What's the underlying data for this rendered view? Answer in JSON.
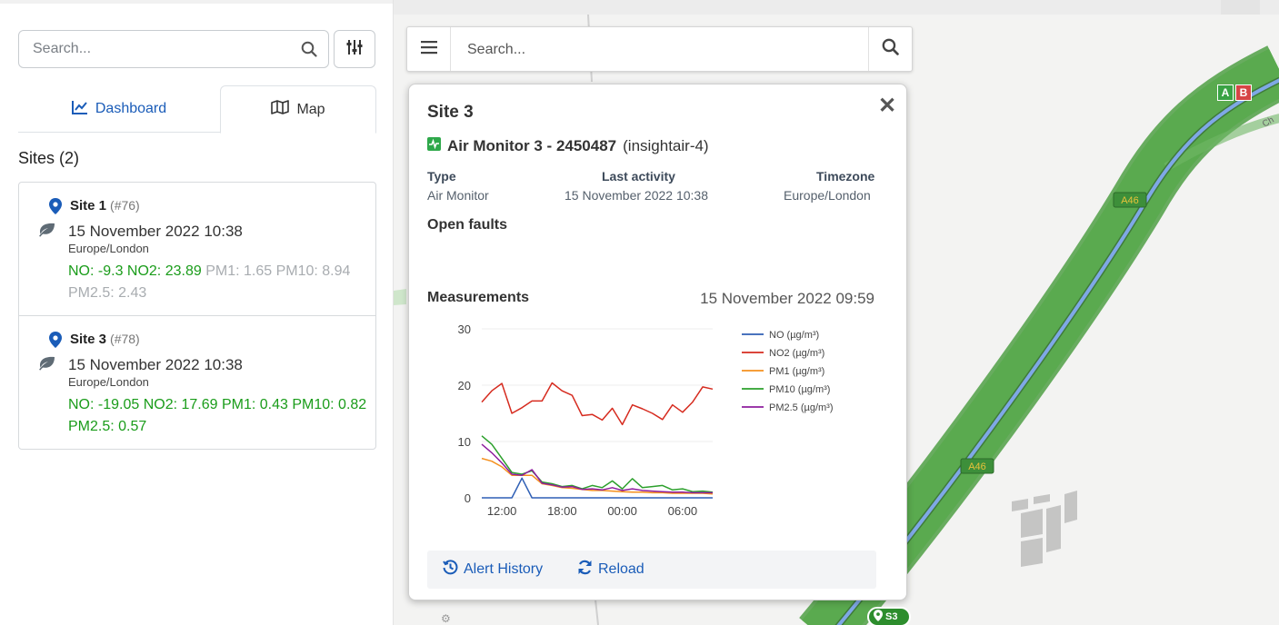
{
  "sidebar": {
    "search_placeholder": "Search...",
    "tabs": [
      {
        "label": "Dashboard",
        "icon": "chart-line-icon",
        "active": false
      },
      {
        "label": "Map",
        "icon": "map-icon",
        "active": true
      }
    ],
    "sites_title": "Sites (2)",
    "sites": [
      {
        "name": "Site 1",
        "id": "(#76)",
        "date": "15 November 2022 10:38",
        "timezone": "Europe/London",
        "values_green": "NO: -9.3 NO2: 23.89",
        "values_grey": "PM1: 1.65 PM10: 8.94 PM2.5: 2.43"
      },
      {
        "name": "Site 3",
        "id": "(#78)",
        "date": "15 November 2022 10:38",
        "timezone": "Europe/London",
        "values_green": "NO: -19.05 NO2: 17.69 PM1: 0.43 PM10: 0.82 PM2.5: 0.57",
        "values_grey": ""
      }
    ]
  },
  "map": {
    "search_placeholder": "Search...",
    "road_label": "A46",
    "flags": [
      "A",
      "B"
    ],
    "marker_label": "S3"
  },
  "popup": {
    "title": "Site 3",
    "device_name": "Air Monitor 3 - 2450487",
    "device_id": "(insightair-4)",
    "type_label": "Type",
    "type_value": "Air Monitor",
    "activity_label": "Last activity",
    "activity_value": "15 November 2022 10:38",
    "timezone_label": "Timezone",
    "timezone_value": "Europe/London",
    "faults_label": "Open faults",
    "measurements_label": "Measurements",
    "measurements_date": "15 November 2022 09:59",
    "alert_history_label": "Alert History",
    "reload_label": "Reload"
  },
  "colors": {
    "primary": "#1a5cb8",
    "green_value": "#1a9c1a",
    "route": "#5aaa4f"
  },
  "chart_data": {
    "type": "line",
    "x": [
      "10:00",
      "11:00",
      "12:00",
      "13:00",
      "14:00",
      "15:00",
      "16:00",
      "17:00",
      "18:00",
      "19:00",
      "20:00",
      "21:00",
      "22:00",
      "23:00",
      "00:00",
      "01:00",
      "02:00",
      "03:00",
      "04:00",
      "05:00",
      "06:00",
      "07:00",
      "08:00",
      "09:00"
    ],
    "xticks": [
      "12:00",
      "18:00",
      "00:00",
      "06:00"
    ],
    "yticks": [
      0,
      10,
      20,
      30
    ],
    "ylim": [
      0,
      30
    ],
    "series": [
      {
        "name": "NO (µg/m³)",
        "color": "#2f5fb5",
        "values": [
          0,
          0,
          0,
          0,
          3.5,
          0,
          0,
          0,
          0,
          0,
          0,
          0,
          0,
          0,
          0,
          0,
          0,
          0,
          0,
          0,
          0,
          0,
          0,
          0
        ]
      },
      {
        "name": "NO2 (µg/m³)",
        "color": "#d62b1f",
        "values": [
          17,
          19,
          20.3,
          15,
          16,
          17.2,
          17.2,
          20.4,
          19,
          18.2,
          14.6,
          14.8,
          13.8,
          15.9,
          13,
          16.5,
          15.8,
          15,
          13.9,
          16.5,
          15.2,
          17,
          19.7,
          19.3
        ]
      },
      {
        "name": "PM1 (µg/m³)",
        "color": "#f5901e",
        "values": [
          7,
          6.5,
          5.5,
          4,
          4,
          4,
          2.5,
          2.2,
          1.8,
          1.7,
          1.5,
          1.3,
          1.3,
          1.2,
          1.1,
          1,
          1,
          0.9,
          0.9,
          0.8,
          0.8,
          0.8,
          0.8,
          0.7
        ]
      },
      {
        "name": "PM10 (µg/m³)",
        "color": "#2ca02c",
        "values": [
          11,
          9.5,
          7,
          4.5,
          4.2,
          4.8,
          2.8,
          2.5,
          2,
          2.2,
          1.6,
          2.2,
          1.8,
          3,
          1.6,
          3.4,
          1.8,
          2,
          2.2,
          1.4,
          1.6,
          1.1,
          1.2,
          1
        ]
      },
      {
        "name": "PM2.5 (µg/m³)",
        "color": "#8e1e9e",
        "values": [
          9.5,
          8,
          6.2,
          4.2,
          4,
          5,
          2.6,
          2.3,
          1.9,
          2,
          1.5,
          1.6,
          1.4,
          1.8,
          1.3,
          1.6,
          1.3,
          1.2,
          1.1,
          1,
          1,
          0.9,
          0.9,
          0.9
        ]
      }
    ]
  }
}
